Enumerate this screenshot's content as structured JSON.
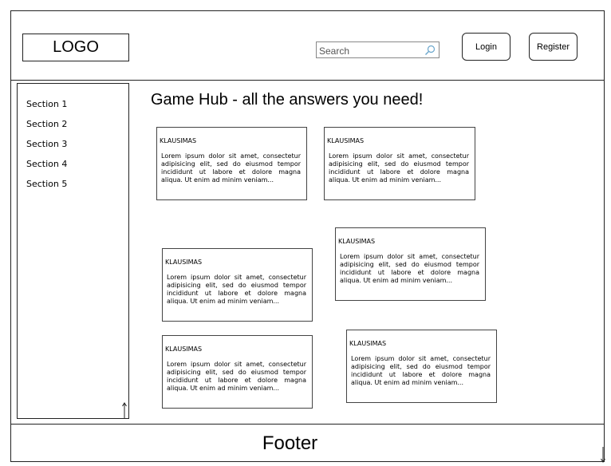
{
  "header": {
    "logo_text": "LOGO",
    "search_placeholder": "Search",
    "login_label": "Login",
    "register_label": "Register"
  },
  "sidebar": {
    "items": [
      {
        "label": "Section 1"
      },
      {
        "label": "Section 2"
      },
      {
        "label": "Section 3"
      },
      {
        "label": "Section 4"
      },
      {
        "label": "Section 5"
      }
    ]
  },
  "main": {
    "title": "Game Hub - all the answers you need!",
    "cards": [
      {
        "heading": "KLAUSIMAS",
        "body": "Lorem ipsum dolor sit amet, consectetur adipisicing elit, sed do eiusmod tempor incididunt ut labore et dolore magna aliqua. Ut enim ad minim veniam..."
      },
      {
        "heading": "KLAUSIMAS",
        "body": "Lorem ipsum dolor sit amet, consectetur adipisicing elit, sed do eiusmod tempor incididunt ut labore et dolore magna aliqua. Ut enim ad minim veniam..."
      },
      {
        "heading": "KLAUSIMAS",
        "body": "Lorem ipsum dolor sit amet, consectetur adipisicing elit, sed do eiusmod tempor incididunt ut labore et dolore magna aliqua. Ut enim ad minim veniam..."
      },
      {
        "heading": "KLAUSIMAS",
        "body": "Lorem ipsum dolor sit amet, consectetur adipisicing elit, sed do eiusmod tempor incididunt ut labore et dolore magna aliqua. Ut enim ad minim veniam..."
      },
      {
        "heading": "KLAUSIMAS",
        "body": "Lorem ipsum dolor sit amet, consectetur adipisicing elit, sed do eiusmod tempor incididunt ut labore et dolore magna aliqua. Ut enim ad minim veniam..."
      },
      {
        "heading": "KLAUSIMAS",
        "body": "Lorem ipsum dolor sit amet, consectetur adipisicing elit, sed do eiusmod tempor incididunt ut labore et dolore magna aliqua. Ut enim ad minim veniam..."
      }
    ]
  },
  "footer": {
    "text": "Footer"
  },
  "icons": {
    "search": "search-icon",
    "scroll": "scroll-arrow-icon",
    "resize": "resize-arrow-icon"
  }
}
